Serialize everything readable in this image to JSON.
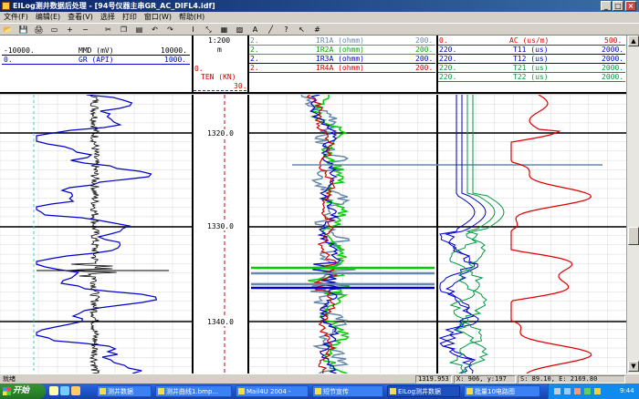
{
  "window": {
    "title": "EILog测井数据后处理 - [94号仪器主串GR_AC_DIFL4.idf]",
    "min_label": "_",
    "max_label": "□",
    "close_label": "×"
  },
  "menu": [
    "文件(F)",
    "编辑(E)",
    "查看(V)",
    "选择",
    "打印",
    "窗口(W)",
    "帮助(H)"
  ],
  "toolbar_icons": [
    "open-icon",
    "save-icon",
    "print-icon",
    "preview-icon",
    "zoom-in-icon",
    "zoom-out-icon",
    "cut-icon",
    "copy-icon",
    "paste-icon",
    "undo-icon",
    "redo-icon",
    "depth-icon",
    "curve-icon",
    "track-icon",
    "fill-icon",
    "text-icon",
    "line-icon",
    "help-icon",
    "pointer-icon",
    "grid-icon"
  ],
  "header": {
    "track1": {
      "mmd": {
        "left": "-10000.",
        "name": "MMD (mV)",
        "right": "10000."
      },
      "gr": {
        "left": "0.",
        "name": "GR (API)",
        "right": "1000."
      }
    },
    "depth": {
      "scale": "1:200",
      "unit": "m",
      "ten_left": "0.",
      "ten_name": "TEN (KN)",
      "ten_right": "30."
    },
    "track2": [
      {
        "left": "2.",
        "name": "IR1A (ohmm)",
        "right": "200."
      },
      {
        "left": "2.",
        "name": "IR2A (ohmm)",
        "right": "200."
      },
      {
        "left": "2.",
        "name": "IR3A (ohmm)",
        "right": "200."
      },
      {
        "left": "2.",
        "name": "IR4A (ohmm)",
        "right": "200."
      }
    ],
    "track3": [
      {
        "left": "0.",
        "name": "AC (us/m)",
        "right": "500."
      },
      {
        "left": "220.",
        "name": "T11 (us)",
        "right": "2000."
      },
      {
        "left": "220.",
        "name": "T12 (us)",
        "right": "2000."
      },
      {
        "left": "220.",
        "name": "T21 (us)",
        "right": "2000."
      },
      {
        "left": "220.",
        "name": "T22 (us)",
        "right": "2000."
      }
    ]
  },
  "depth_labels": [
    "1320.0",
    "1330.0",
    "1340.0"
  ],
  "colors": {
    "mmd": "#000000",
    "gr": "#0000cc",
    "ten": "#cc0000",
    "ir1a": "#6688aa",
    "ir2a": "#00cc00",
    "ir3a": "#0000cc",
    "ir4a": "#cc0000",
    "ac": "#dd0000",
    "t11": "#0000cc",
    "t12": "#0000cc",
    "t21": "#009944",
    "t22": "#009944"
  },
  "status": {
    "text": "就绪",
    "depth": "1319.953",
    "pos": "X: 906, y:197",
    "sx": "S: 89.10, E: 2169.80"
  },
  "taskbar": {
    "start": "开始",
    "buttons": [
      "测井数据",
      "测井曲线1.bmp...",
      "Mail4U 2004 -",
      "短节宣传",
      "EILog测井数据",
      "批量10电路图"
    ],
    "clock": "9:44"
  }
}
